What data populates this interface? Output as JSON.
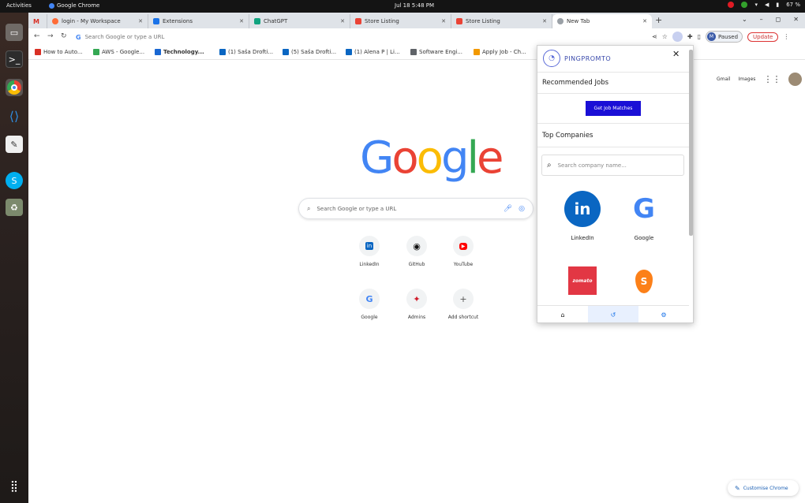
{
  "system": {
    "activities": "Activities",
    "app_name": "Google Chrome",
    "clock": "Jul 18  5:48 PM",
    "battery": "67 %"
  },
  "tabs": [
    {
      "label": "",
      "icon": "gmail-icon",
      "color": "#d93025"
    },
    {
      "label": "login - My Workspace",
      "color": "#ff6c37"
    },
    {
      "label": "Extensions",
      "color": "#1a73e8"
    },
    {
      "label": "ChatGPT",
      "color": "#10a37f"
    },
    {
      "label": "Store Listing",
      "color": "#ea4335"
    },
    {
      "label": "Store Listing",
      "color": "#ea4335"
    },
    {
      "label": "New Tab",
      "color": "#5f6368"
    }
  ],
  "toolbar": {
    "omnibox_placeholder": "Search Google or type a URL",
    "profile_initial": "M",
    "profile_status": "Paused",
    "update_label": "Update"
  },
  "bookmarks": [
    {
      "label": "How to Auto...",
      "color": "#d93025"
    },
    {
      "label": "AWS - Google...",
      "color": "#34a853"
    },
    {
      "label": "Technology...",
      "color": "#1967d2"
    },
    {
      "label": "(1) Saša Drofti...",
      "color": "#0a66c2"
    },
    {
      "label": "(5) Saša Drofti...",
      "color": "#0a66c2"
    },
    {
      "label": "(1) Alena P | Li...",
      "color": "#0a66c2"
    },
    {
      "label": "Software Engi...",
      "color": "#5f6368"
    },
    {
      "label": "Apply Job - Ch...",
      "color": "#f29900"
    }
  ],
  "ntp": {
    "gmail": "Gmail",
    "images": "Images",
    "search_placeholder": "Search Google or type a URL",
    "logo_letters": [
      "G",
      "o",
      "o",
      "g",
      "l",
      "e"
    ],
    "shortcuts": [
      {
        "label": "LinkedIn",
        "glyph": "in",
        "color": "#0a66c2"
      },
      {
        "label": "GitHub",
        "glyph": "◉",
        "color": "#111"
      },
      {
        "label": "YouTube",
        "glyph": "▶",
        "color": "#ff0000"
      },
      {
        "label": "Google",
        "glyph": "G",
        "color": "#4285f4"
      },
      {
        "label": "Admins",
        "glyph": "✦",
        "color": "#d01c2b"
      },
      {
        "label": "Add shortcut",
        "glyph": "+",
        "color": "#555"
      }
    ],
    "customize_label": "Customise Chrome"
  },
  "popup": {
    "brand": "PINGPROMTO",
    "recommended_heading": "Recommended Jobs",
    "job_button": "Get Job Matches",
    "companies_heading": "Top Companies",
    "search_placeholder": "Search company name...",
    "companies": [
      {
        "name": "LinkedIn",
        "glyph": "in",
        "bg": "#0a66c2"
      },
      {
        "name": "Google",
        "glyph": "G",
        "bg": "#ffffff"
      },
      {
        "name": "",
        "glyph": "zomato",
        "bg": "#e23744"
      },
      {
        "name": "",
        "glyph": "S",
        "bg": "#fc8019"
      }
    ],
    "nav_active_bg": "#e8f0fe"
  }
}
